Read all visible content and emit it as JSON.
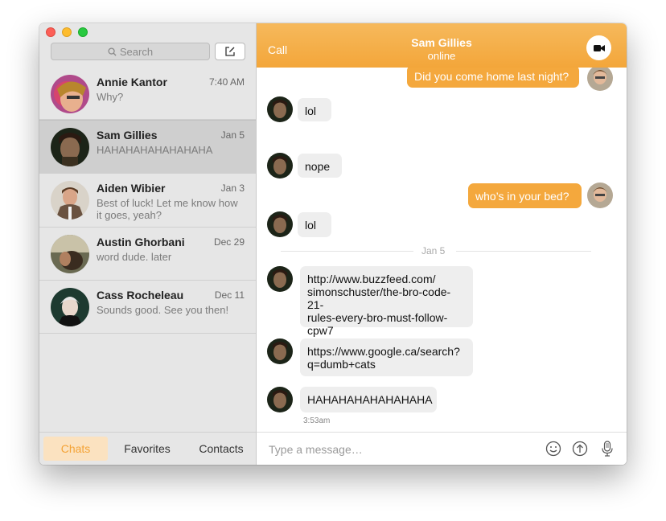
{
  "sidebar": {
    "search_placeholder": "Search",
    "conversations": [
      {
        "name": "Annie Kantor",
        "time": "7:40 AM",
        "preview": "Why?"
      },
      {
        "name": "Sam Gillies",
        "time": "Jan 5",
        "preview": "HAHAHAHAHAHAHAHA"
      },
      {
        "name": "Aiden Wibier",
        "time": "Jan 3",
        "preview": "Best of luck! Let me know how it goes, yeah?"
      },
      {
        "name": "Austin Ghorbani",
        "time": "Dec 29",
        "preview": "word dude. later"
      },
      {
        "name": "Cass Rocheleau",
        "time": "Dec 11",
        "preview": "Sounds good. See you then!"
      }
    ],
    "tabs": {
      "chats": "Chats",
      "favorites": "Favorites",
      "contacts": "Contacts"
    }
  },
  "chat": {
    "call_label": "Call",
    "contact_name": "Sam Gillies",
    "contact_status": "online",
    "messages": [
      "Did you come home last night?",
      "lol",
      "nope",
      "who’s in your bed?",
      "lol",
      "http://www.buzzfeed.com/\nsimonschuster/the-bro-code-21-\nrules-every-bro-must-follow-\ncpw7",
      "https://www.google.ca/search?\nq=dumb+cats",
      "HAHAHAHAHAHAHAHA"
    ],
    "date_divider": "Jan 5",
    "last_timestamp": "3:53am",
    "composer_placeholder": "Type a message…"
  },
  "colors": {
    "accent": "#f4a83d",
    "header_gradient_top": "#f6b95c",
    "incoming_bubble": "#eeeeee",
    "sidebar_bg": "#e6e6e6"
  },
  "icons": [
    "search-icon",
    "compose-icon",
    "video-camera-icon",
    "emoji-icon",
    "upload-icon",
    "microphone-icon"
  ]
}
